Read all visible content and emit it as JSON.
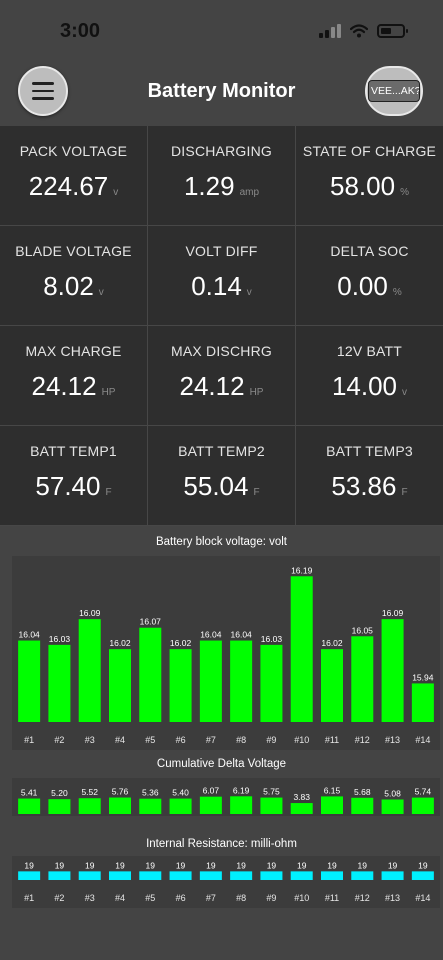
{
  "status_bar": {
    "time": "3:00"
  },
  "header": {
    "title": "Battery Monitor",
    "device_button": "VEE...AK?"
  },
  "tiles": [
    {
      "label": "PACK VOLTAGE",
      "value": "224.67",
      "unit": "v"
    },
    {
      "label": "DISCHARGING",
      "value": "1.29",
      "unit": "amp"
    },
    {
      "label": "STATE OF CHARGE",
      "value": "58.00",
      "unit": "%"
    },
    {
      "label": "BLADE VOLTAGE",
      "value": "8.02",
      "unit": "v"
    },
    {
      "label": "VOLT DIFF",
      "value": "0.14",
      "unit": "v"
    },
    {
      "label": "DELTA SOC",
      "value": "0.00",
      "unit": "%"
    },
    {
      "label": "MAX CHARGE",
      "value": "24.12",
      "unit": "HP"
    },
    {
      "label": "MAX DISCHRG",
      "value": "24.12",
      "unit": "HP"
    },
    {
      "label": "12V BATT",
      "value": "14.00",
      "unit": "v"
    },
    {
      "label": "BATT TEMP1",
      "value": "57.40",
      "unit": "F"
    },
    {
      "label": "BATT TEMP2",
      "value": "55.04",
      "unit": "F"
    },
    {
      "label": "BATT TEMP3",
      "value": "53.86",
      "unit": "F"
    }
  ],
  "colors": {
    "bar_green": "#00ff00",
    "bar_cyan": "#00f0ff",
    "background": "#444444",
    "tile_background": "#2e2e2e"
  },
  "chart_data": [
    {
      "type": "bar",
      "title": "Battery block voltage: volt",
      "categories": [
        "#1",
        "#2",
        "#3",
        "#4",
        "#5",
        "#6",
        "#7",
        "#8",
        "#9",
        "#10",
        "#11",
        "#12",
        "#13",
        "#14"
      ],
      "values": [
        16.04,
        16.03,
        16.09,
        16.02,
        16.07,
        16.02,
        16.04,
        16.04,
        16.03,
        16.19,
        16.02,
        16.05,
        16.09,
        15.94
      ],
      "value_labels": [
        "16.04",
        "16.03",
        "16.09",
        "16.02",
        "16.07",
        "16.02",
        "16.04",
        "16.04",
        "16.03",
        "16.19",
        "16.02",
        "16.05",
        "16.09",
        "15.94"
      ],
      "ylim": [
        15.85,
        16.2
      ],
      "color": "#00ff00"
    },
    {
      "type": "bar",
      "title": "Cumulative Delta Voltage",
      "categories": [
        "#1",
        "#2",
        "#3",
        "#4",
        "#5",
        "#6",
        "#7",
        "#8",
        "#9",
        "#10",
        "#11",
        "#12",
        "#13",
        "#14"
      ],
      "values": [
        5.41,
        5.2,
        5.52,
        5.76,
        5.36,
        5.4,
        6.07,
        6.19,
        5.75,
        3.83,
        6.15,
        5.68,
        5.08,
        5.74
      ],
      "value_labels": [
        "5.41",
        "5.20",
        "5.52",
        "5.76",
        "5.36",
        "5.40",
        "6.07",
        "6.19",
        "5.75",
        "3.83",
        "6.15",
        "5.68",
        "5.08",
        "5.74"
      ],
      "ylim": [
        0,
        14
      ],
      "color": "#00ff00"
    },
    {
      "type": "bar",
      "title": "Internal Resistance: milli-ohm",
      "categories": [
        "#1",
        "#2",
        "#3",
        "#4",
        "#5",
        "#6",
        "#7",
        "#8",
        "#9",
        "#10",
        "#11",
        "#12",
        "#13",
        "#14"
      ],
      "values": [
        19,
        19,
        19,
        19,
        19,
        19,
        19,
        19,
        19,
        19,
        19,
        19,
        19,
        19
      ],
      "value_labels": [
        "19",
        "19",
        "19",
        "19",
        "19",
        "19",
        "19",
        "19",
        "19",
        "19",
        "19",
        "19",
        "19",
        "19"
      ],
      "ylim": [
        0,
        220
      ],
      "color": "#00f0ff"
    }
  ]
}
